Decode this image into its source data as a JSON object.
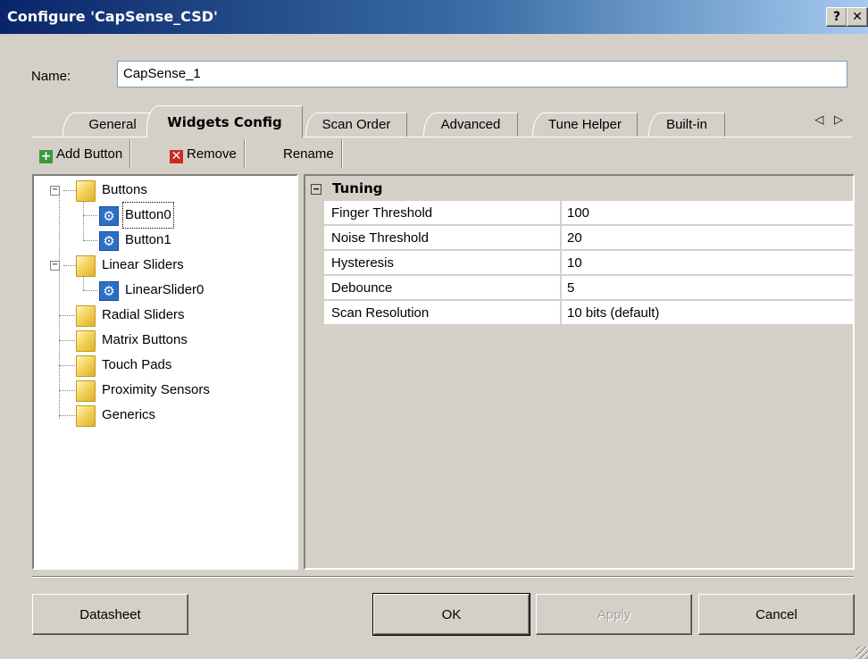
{
  "window": {
    "title": "Configure 'CapSense_CSD'",
    "help_label": "?",
    "close_label": "✕"
  },
  "name": {
    "label": "Name:",
    "value": "CapSense_1"
  },
  "tabs": [
    {
      "label": "General",
      "active": false
    },
    {
      "label": "Widgets Config",
      "active": true
    },
    {
      "label": "Scan Order",
      "active": false
    },
    {
      "label": "Advanced",
      "active": false
    },
    {
      "label": "Tune Helper",
      "active": false
    },
    {
      "label": "Built-in",
      "active": false
    }
  ],
  "tab_scroll": "◁ ▷",
  "toolbar": {
    "add_label": "Add Button",
    "remove_label": "Remove",
    "rename_label": "Rename"
  },
  "tree": {
    "buttons": "Buttons",
    "button0": "Button0",
    "button1": "Button1",
    "linear_sliders": "Linear Sliders",
    "linear_slider0": "LinearSlider0",
    "radial_sliders": "Radial Sliders",
    "matrix_buttons": "Matrix Buttons",
    "touch_pads": "Touch Pads",
    "proximity_sensors": "Proximity Sensors",
    "generics": "Generics"
  },
  "properties": {
    "category": "Tuning",
    "rows": [
      {
        "name": "Finger Threshold",
        "value": "100"
      },
      {
        "name": "Noise Threshold",
        "value": "20"
      },
      {
        "name": "Hysteresis",
        "value": "10"
      },
      {
        "name": "Debounce",
        "value": "5"
      },
      {
        "name": "Scan Resolution",
        "value": "10 bits (default)"
      }
    ]
  },
  "footer": {
    "datasheet_label": "Datasheet",
    "ok_label": "OK",
    "apply_label": "Apply",
    "cancel_label": "Cancel"
  },
  "colors": {
    "titlebar_start": "#0a246a",
    "titlebar_end": "#a6caf0",
    "dialog_bg": "#d4d0c8",
    "add_icon": "#3c9a3c",
    "remove_icon": "#cc2a1c",
    "widget_icon": "#2c6fc7"
  },
  "icons": {
    "add": "plus-icon",
    "remove": "x-icon",
    "folder": "folder-icon",
    "widget": "gear-icon"
  }
}
